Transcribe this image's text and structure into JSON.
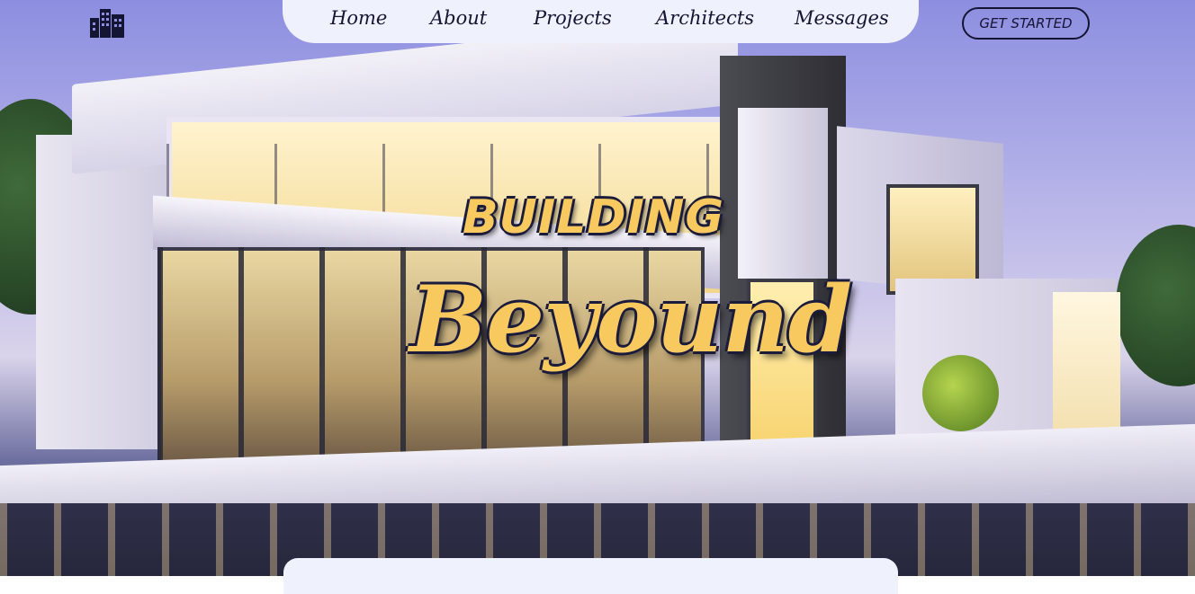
{
  "nav": {
    "items": [
      {
        "label": "Home"
      },
      {
        "label": "About"
      },
      {
        "label": "Projects"
      },
      {
        "label": "Architects"
      },
      {
        "label": "Messages"
      }
    ],
    "cta_label": "GET STARTED"
  },
  "hero": {
    "headline_top": "BUILDING",
    "headline_main": "Beyound"
  },
  "colors": {
    "accent": "#f7c95e",
    "nav_background": "#eff1fd",
    "text_dark": "#141433"
  },
  "icons": {
    "logo": "building-icon"
  }
}
